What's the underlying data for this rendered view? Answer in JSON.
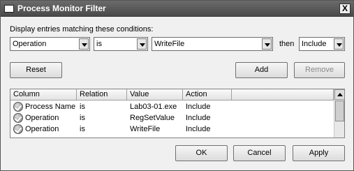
{
  "window": {
    "title": "Process Monitor Filter",
    "close_glyph": "X"
  },
  "filter": {
    "instruction": "Display entries matching these conditions:",
    "column_value": "Operation",
    "relation_value": "is",
    "value_value": "WriteFile",
    "then_label": "then",
    "action_value": "Include"
  },
  "buttons": {
    "reset": "Reset",
    "add": "Add",
    "remove": "Remove",
    "ok": "OK",
    "cancel": "Cancel",
    "apply": "Apply"
  },
  "list": {
    "headers": [
      "Column",
      "Relation",
      "Value",
      "Action"
    ],
    "rows": [
      {
        "column": "Process Name",
        "relation": "is",
        "value": "Lab03-01.exe",
        "action": "Include",
        "icon": "check-icon"
      },
      {
        "column": "Operation",
        "relation": "is",
        "value": "RegSetValue",
        "action": "Include",
        "icon": "check-icon"
      },
      {
        "column": "Operation",
        "relation": "is",
        "value": "WriteFile",
        "action": "Include",
        "icon": "check-icon"
      }
    ]
  }
}
